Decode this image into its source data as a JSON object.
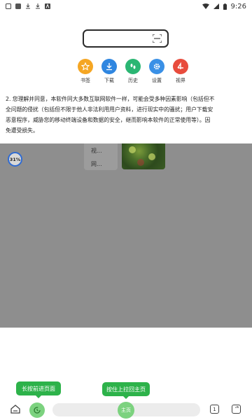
{
  "status": {
    "time": "9:26"
  },
  "quick": [
    {
      "label": "书签",
      "icon": "star-icon",
      "color": "#f5a623"
    },
    {
      "label": "下载",
      "icon": "download-icon",
      "color": "#2f86e0"
    },
    {
      "label": "历史",
      "icon": "footprint-icon",
      "color": "#2bb673"
    },
    {
      "label": "设置",
      "icon": "gear-icon",
      "color": "#3a90e6"
    },
    {
      "label": "视界",
      "icon": "vision-icon",
      "color": "#e84c3d"
    }
  ],
  "notice": {
    "lines": [
      "2. 您理解并同意，本软件同大多数互联网软件一样，可能会受多种因素影响（包括但不",
      "全问题的侵扰（包括但不限于他人非法利用用户资料，进行现实中的骚扰；用户下载安",
      "恶意程序，威胁您的移动终端设备和数据的安全，继而影响本软件的正常使用等）。因",
      "免遭受损失。"
    ]
  },
  "overlay": {
    "items": [
      "视...",
      "网..."
    ],
    "progress": "31%"
  },
  "tips": {
    "left": "长按前进页面",
    "mid": "按住上拉回主页"
  },
  "bottom": {
    "main_label": "主页",
    "tab_count": "1"
  }
}
